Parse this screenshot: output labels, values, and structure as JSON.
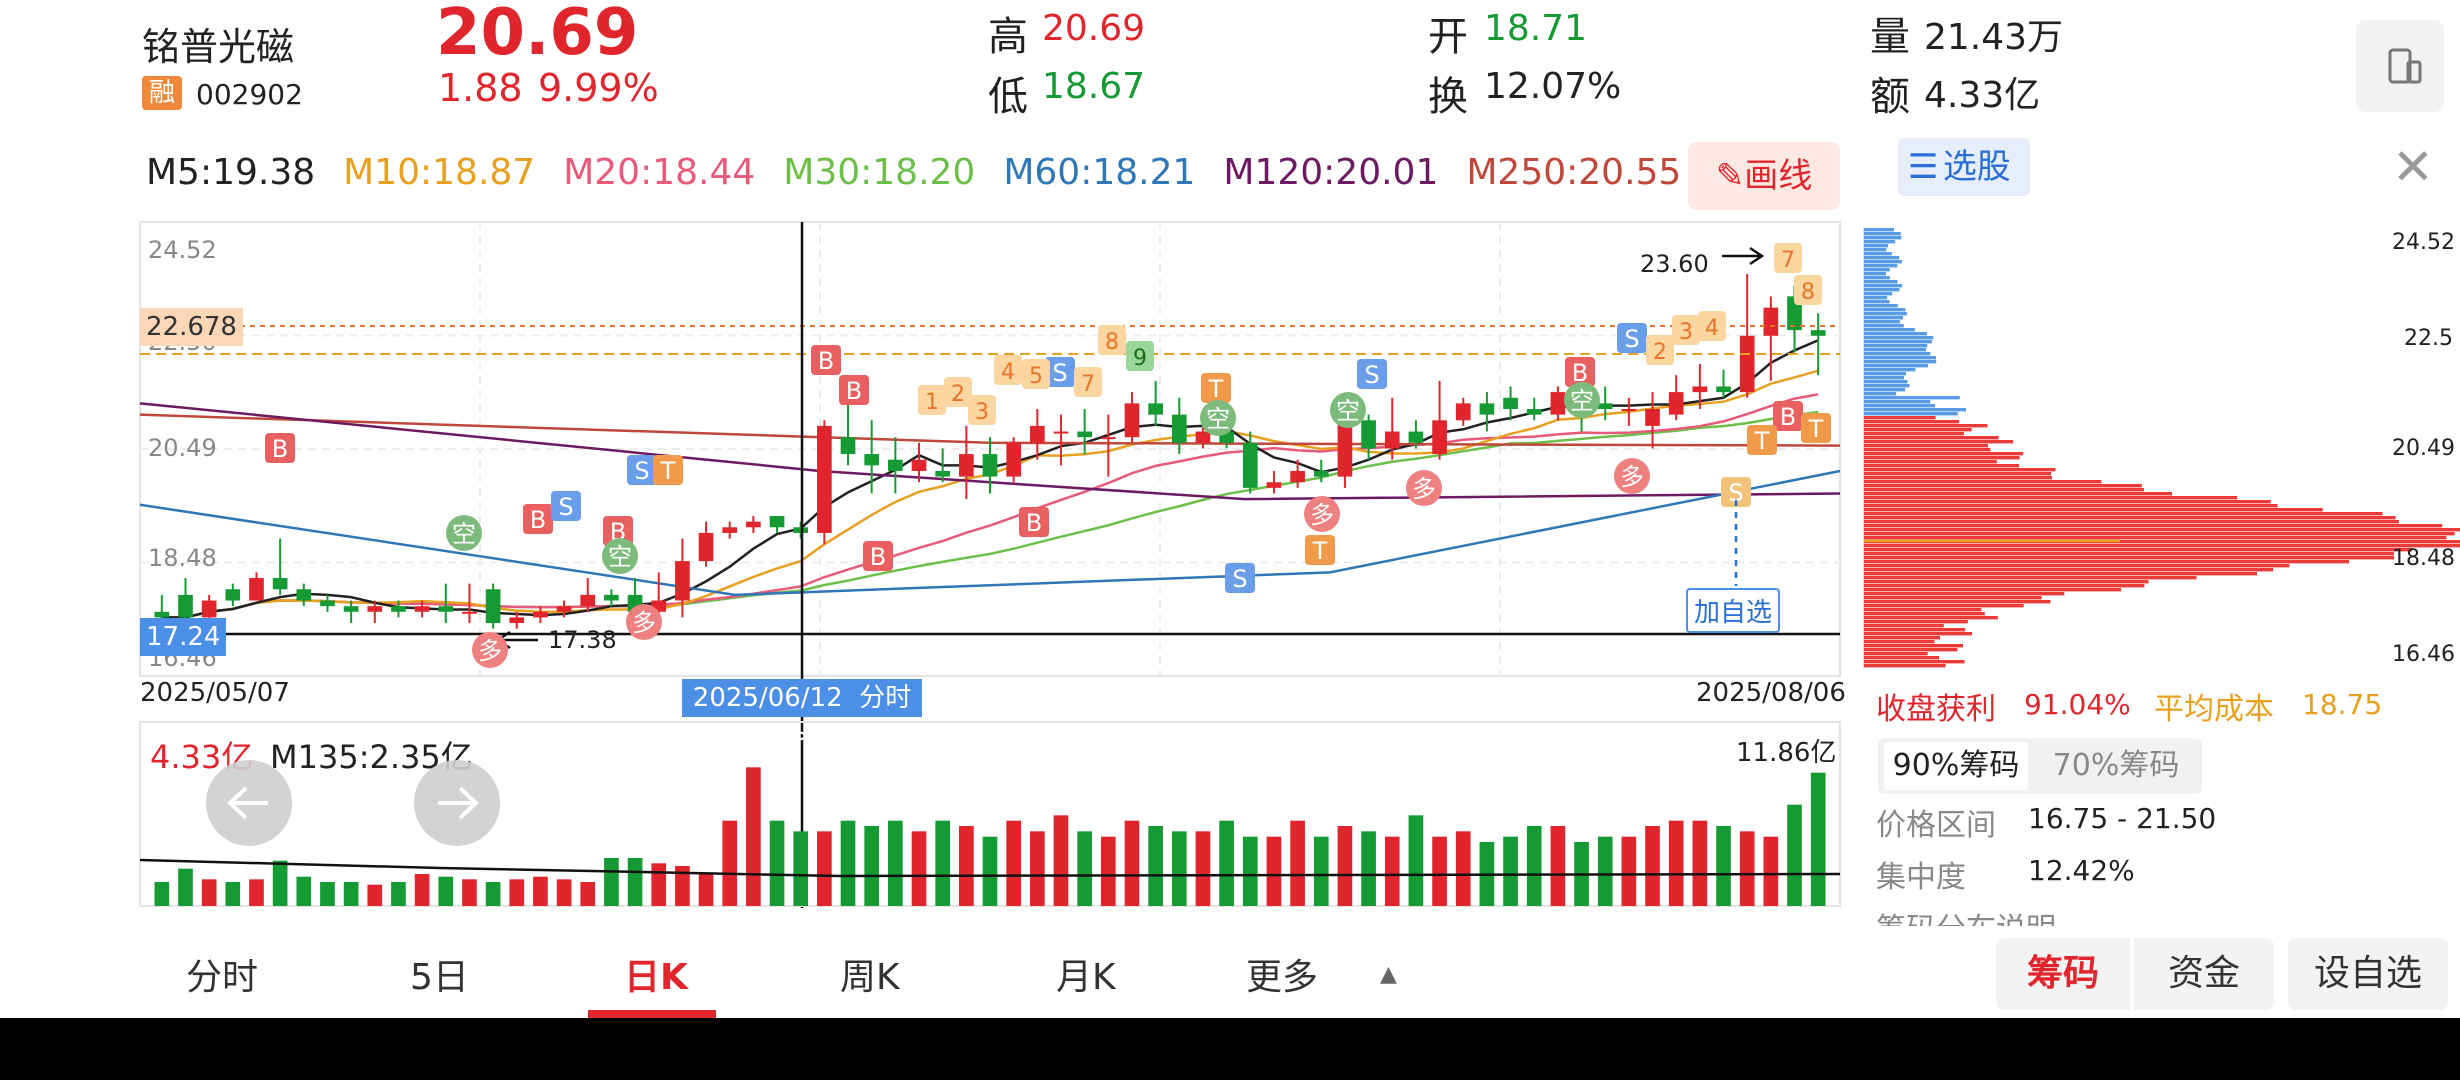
{
  "header": {
    "stock_name": "铭普光磁",
    "rong_badge": "融",
    "code": "002902",
    "price": "20.69",
    "change": "1.88",
    "change_pct": "9.99%",
    "high_label": "高",
    "high": "20.69",
    "low_label": "低",
    "low": "18.67",
    "open_label": "开",
    "open": "18.71",
    "turnover_label": "换",
    "turnover": "12.07%",
    "volume_label": "量",
    "volume": "21.43万",
    "amount_label": "额",
    "amount": "4.33亿"
  },
  "ma": [
    {
      "label": "M5:19.38",
      "color": "#222222"
    },
    {
      "label": "M10:18.87",
      "color": "#e8a020"
    },
    {
      "label": "M20:18.44",
      "color": "#e85a7a"
    },
    {
      "label": "M30:18.20",
      "color": "#6cc04a"
    },
    {
      "label": "M60:18.21",
      "color": "#2f77b7"
    },
    {
      "label": "M120:20.01",
      "color": "#6e1a63"
    },
    {
      "label": "M250:20.55",
      "color": "#c0483a"
    }
  ],
  "draw_button": "画线",
  "kline": {
    "y_ticks": [
      "24.52",
      "22.50",
      "20.49",
      "18.48",
      "16.46"
    ],
    "price_tag": "22.678",
    "price_min_tag": "17.24",
    "high_marker": "23.60",
    "low_marker": "17.38",
    "start_date": "2025/05/07",
    "cursor_date": "2025/06/12",
    "cursor_link": "分时 >",
    "end_date": "2025/08/06",
    "add_watch": "加自选",
    "signals": [
      "B",
      "S",
      "T",
      "空",
      "多",
      "1",
      "2",
      "3",
      "4",
      "5",
      "7",
      "8",
      "9"
    ]
  },
  "volume_panel": {
    "amount": "4.33亿",
    "ma_label": "M135:2.35亿",
    "max_label": "11.86亿"
  },
  "chips": {
    "title": "选股",
    "y_ticks": [
      "24.52",
      "22.5",
      "20.49",
      "18.48",
      "16.46"
    ],
    "profit_label": "收盘获利",
    "profit_value": "91.04%",
    "avg_cost_label": "平均成本",
    "avg_cost_value": "18.75",
    "tab_90": "90%筹码",
    "tab_70": "70%筹码",
    "range_label": "价格区间",
    "range_value": "16.75 - 21.50",
    "concentration_label": "集中度",
    "concentration_value": "12.42%",
    "explain_label": "筹码分布说明"
  },
  "tabs": [
    "分时",
    "5日",
    "日K",
    "周K",
    "月K",
    "更多"
  ],
  "active_tab": "日K",
  "right_buttons": {
    "chips": "筹码",
    "funds": "资金",
    "add": "设自选"
  },
  "chart_data": {
    "type": "candlestick",
    "series_note": "",
    "y_range": [
      16.46,
      24.52
    ],
    "candles": [
      [
        17.6,
        17.9,
        17.3,
        17.5
      ],
      [
        17.9,
        18.2,
        17.4,
        17.5
      ],
      [
        17.5,
        17.9,
        17.4,
        17.8
      ],
      [
        18.0,
        18.1,
        17.7,
        17.8
      ],
      [
        17.8,
        18.3,
        17.8,
        18.2
      ],
      [
        18.2,
        18.9,
        17.9,
        18.0
      ],
      [
        18.0,
        18.1,
        17.7,
        17.8
      ],
      [
        17.8,
        17.9,
        17.6,
        17.7
      ],
      [
        17.7,
        17.8,
        17.4,
        17.6
      ],
      [
        17.6,
        17.8,
        17.4,
        17.7
      ],
      [
        17.7,
        17.8,
        17.5,
        17.6
      ],
      [
        17.6,
        17.8,
        17.5,
        17.7
      ],
      [
        17.7,
        18.1,
        17.4,
        17.6
      ],
      [
        17.6,
        18.1,
        17.4,
        17.6
      ],
      [
        18.0,
        18.1,
        17.3,
        17.4
      ],
      [
        17.4,
        17.6,
        17.3,
        17.5
      ],
      [
        17.5,
        17.7,
        17.4,
        17.6
      ],
      [
        17.6,
        17.8,
        17.5,
        17.7
      ],
      [
        17.7,
        18.2,
        17.6,
        17.9
      ],
      [
        17.9,
        18.0,
        17.7,
        17.8
      ],
      [
        17.9,
        18.2,
        17.5,
        17.6
      ],
      [
        17.6,
        18.3,
        17.5,
        17.8
      ],
      [
        17.8,
        18.9,
        17.5,
        18.5
      ],
      [
        18.5,
        19.2,
        18.4,
        19.0
      ],
      [
        19.0,
        19.2,
        18.9,
        19.1
      ],
      [
        19.1,
        19.3,
        19.0,
        19.2
      ],
      [
        19.3,
        19.3,
        19.0,
        19.1
      ],
      [
        19.1,
        19.2,
        18.9,
        19.0
      ],
      [
        19.0,
        21.0,
        18.8,
        20.9
      ],
      [
        20.7,
        21.6,
        20.2,
        20.4
      ],
      [
        20.4,
        21.0,
        19.7,
        20.2
      ],
      [
        20.3,
        20.7,
        19.7,
        20.1
      ],
      [
        20.1,
        20.6,
        19.9,
        20.3
      ],
      [
        20.1,
        20.5,
        19.9,
        20.0
      ],
      [
        20.0,
        20.9,
        19.6,
        20.4
      ],
      [
        20.4,
        20.7,
        19.7,
        20.0
      ],
      [
        20.0,
        20.7,
        19.9,
        20.6
      ],
      [
        20.6,
        21.2,
        20.3,
        20.9
      ],
      [
        20.8,
        21.1,
        20.2,
        20.8
      ],
      [
        20.8,
        21.2,
        20.4,
        20.7
      ],
      [
        20.7,
        21.1,
        20.0,
        20.7
      ],
      [
        20.7,
        21.5,
        20.6,
        21.3
      ],
      [
        21.3,
        21.7,
        20.9,
        21.1
      ],
      [
        21.1,
        21.4,
        20.4,
        20.6
      ],
      [
        20.6,
        20.9,
        20.5,
        20.8
      ],
      [
        20.8,
        20.9,
        20.5,
        20.6
      ],
      [
        20.6,
        20.8,
        19.7,
        19.8
      ],
      [
        19.8,
        20.1,
        19.7,
        19.9
      ],
      [
        19.9,
        20.3,
        19.8,
        20.1
      ],
      [
        20.1,
        20.3,
        19.9,
        20.0
      ],
      [
        20.0,
        21.2,
        19.8,
        21.0
      ],
      [
        21.0,
        21.1,
        20.3,
        20.5
      ],
      [
        20.5,
        21.4,
        20.3,
        20.8
      ],
      [
        20.8,
        21.0,
        20.5,
        20.6
      ],
      [
        20.4,
        21.7,
        20.3,
        21.0
      ],
      [
        21.0,
        21.4,
        20.9,
        21.3
      ],
      [
        21.3,
        21.5,
        20.8,
        21.1
      ],
      [
        21.4,
        21.6,
        21.0,
        21.2
      ],
      [
        21.2,
        21.4,
        21.0,
        21.1
      ],
      [
        21.1,
        21.6,
        21.0,
        21.5
      ],
      [
        21.5,
        21.8,
        20.8,
        21.3
      ],
      [
        21.3,
        21.6,
        21.0,
        21.2
      ],
      [
        21.2,
        21.4,
        20.9,
        21.2
      ],
      [
        20.9,
        21.5,
        20.5,
        21.2
      ],
      [
        21.1,
        21.8,
        21.0,
        21.5
      ],
      [
        21.5,
        22.0,
        21.2,
        21.6
      ],
      [
        21.6,
        21.9,
        21.4,
        21.5
      ],
      [
        21.5,
        23.6,
        21.4,
        22.5
      ],
      [
        22.5,
        23.2,
        21.7,
        23.0
      ],
      [
        23.2,
        23.4,
        22.2,
        22.6
      ],
      [
        22.6,
        22.9,
        21.8,
        22.5
      ]
    ],
    "volumes": [
      0.45,
      0.7,
      0.5,
      0.45,
      0.5,
      0.85,
      0.55,
      0.45,
      0.45,
      0.4,
      0.45,
      0.6,
      0.55,
      0.5,
      0.45,
      0.5,
      0.55,
      0.5,
      0.45,
      0.9,
      0.9,
      0.8,
      0.75,
      0.6,
      1.6,
      2.6,
      1.6,
      1.4,
      1.4,
      1.6,
      1.5,
      1.6,
      1.4,
      1.6,
      1.5,
      1.3,
      1.6,
      1.4,
      1.7,
      1.4,
      1.3,
      1.6,
      1.5,
      1.4,
      1.4,
      1.6,
      1.3,
      1.3,
      1.6,
      1.3,
      1.5,
      1.4,
      1.3,
      1.7,
      1.3,
      1.4,
      1.2,
      1.3,
      1.5,
      1.5,
      1.2,
      1.3,
      1.3,
      1.5,
      1.6,
      1.6,
      1.5,
      1.4,
      1.3,
      1.9,
      2.5
    ]
  }
}
